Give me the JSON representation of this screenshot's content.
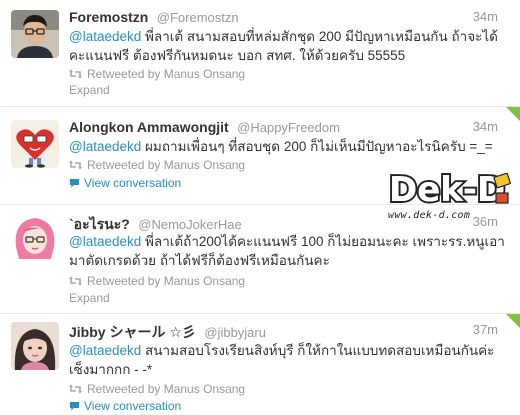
{
  "colors": {
    "link": "#2a8fbd",
    "muted": "#999999",
    "text": "#333333",
    "corner": "#7fc242"
  },
  "tweets": [
    {
      "name": "Foremostzn",
      "handle": "@Foremostzn",
      "time": "34m",
      "mention": "@lataedekd",
      "text": " พี่ลาเต้ สนามสอบที่หล่มสักชุด 200 มีปัญหาเหมือนกัน ถ้าจะได้คะแนนฟรี ต้องฟรีกันหมดนะ บอก สทศ. ให้ด้วยครับ 55555",
      "retweet": "Retweeted by Manus Onsang",
      "action": "Expand",
      "avatar": "photo-portrait"
    },
    {
      "name": "Alongkon Ammawongjit",
      "handle": "@HappyFreedom",
      "time": "34m",
      "mention": "@lataedekd",
      "text": " ผมถามเพื่อนๆ ที่สอบชุด 200 ก็ไม่เห็นมีปัญหาอะไรนิครับ =_=",
      "retweet": "Retweeted by Manus Onsang",
      "action": "View conversation",
      "avatar": "heart-cartoon"
    },
    {
      "name": "`อะไรนะ?",
      "handle": "@NemoJokerHae",
      "time": "36m",
      "mention": "@lataedekd",
      "text": " พี่ลาเต้ถ้า200ได้คะแนนฟรี 100 ก็ไม่ยอมนะคะ เพราะรร.หนูเอามาตัดเกรดด้วย ถ้าได้ฟรีก็ต้องฟรีเหมือนกันคะ",
      "retweet": "Retweeted by Manus Onsang",
      "action": "Expand",
      "avatar": "pink-cartoon-girl"
    },
    {
      "name": "Jibby シャール ☆彡",
      "handle": "@jibbyjaru",
      "time": "37m",
      "mention": "@lataedekd",
      "text": " สนามสอบโรงเรียนสิงห์บุรี ก็ให้กาในแบบทดสอบเหมือนกันค่ะ เซ็งมากกก - -*",
      "retweet": "Retweeted by Manus Onsang",
      "action": "View conversation",
      "avatar": "photo-portrait"
    }
  ],
  "watermark": {
    "logo": "Dek-D",
    "url": "www.dek-d.com"
  }
}
